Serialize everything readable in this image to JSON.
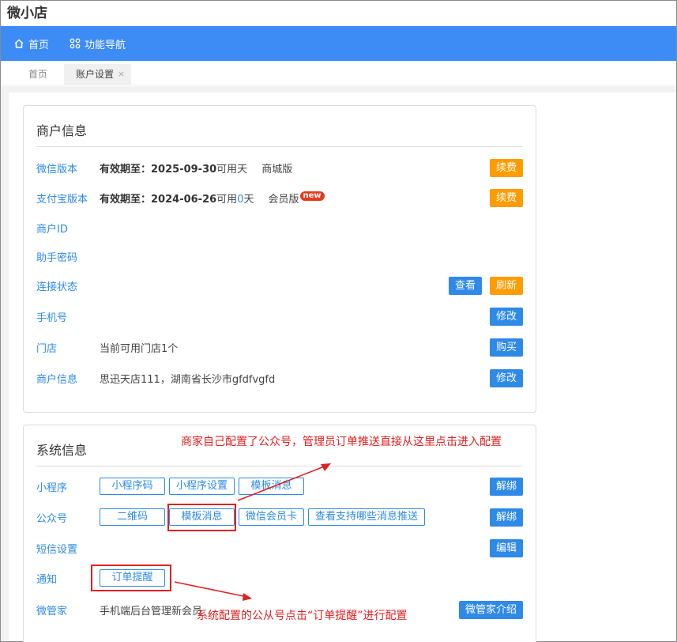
{
  "app": {
    "title": "微小店"
  },
  "topnav": {
    "home": "首页",
    "nav": "功能导航"
  },
  "tabs": [
    {
      "label": "首页"
    },
    {
      "label": "账户设置",
      "close": "×"
    }
  ],
  "merchant": {
    "title": "商户信息",
    "rows": {
      "wechat": {
        "label": "微信版本",
        "prefix": "有效期至：",
        "date": "2025-09-30",
        "suffix": "可用天",
        "edition": "商城版",
        "btn": "续费"
      },
      "alipay": {
        "label": "支付宝版本",
        "prefix": "有效期至：",
        "date": "2024-06-26",
        "mid": "可用",
        "days": "0",
        "unit": "天",
        "edition": "会员版",
        "badge": "new",
        "btn": "续费"
      },
      "id": {
        "label": "商户ID"
      },
      "secret": {
        "label": "助手密码"
      },
      "conn": {
        "label": "连接状态",
        "btn_view": "查看",
        "btn_refresh": "刷新"
      },
      "phone": {
        "label": "手机号",
        "btn": "修改"
      },
      "store": {
        "label": "门店",
        "value": "当前可用门店1个",
        "btn": "购买"
      },
      "info": {
        "label": "商户信息",
        "value": "思迅天店111，湖南省长沙市gfdfvgfd",
        "btn": "修改"
      }
    }
  },
  "system": {
    "title": "系统信息",
    "rows": {
      "mini": {
        "label": "小程序",
        "b1": "小程序码",
        "b2": "小程序设置",
        "b3": "模板消息",
        "btn": "解绑"
      },
      "mp": {
        "label": "公众号",
        "b1": "二维码",
        "b2": "模板消息",
        "b3": "微信会员卡",
        "b4": "查看支持哪些消息推送",
        "btn": "解绑"
      },
      "sms": {
        "label": "短信设置",
        "btn": "编辑"
      },
      "notify": {
        "label": "通知",
        "b1": "订单提醒"
      },
      "steward": {
        "label": "微管家",
        "value": "手机端后台管理新会员",
        "btn": "微管家介绍"
      }
    }
  },
  "annotations": {
    "top": "商家自己配置了公众号，管理员订单推送直接从这里点击进入配置",
    "bottom": "系统配置的公从号点击“订单提醒”进行配置",
    "color": "#e02020"
  }
}
